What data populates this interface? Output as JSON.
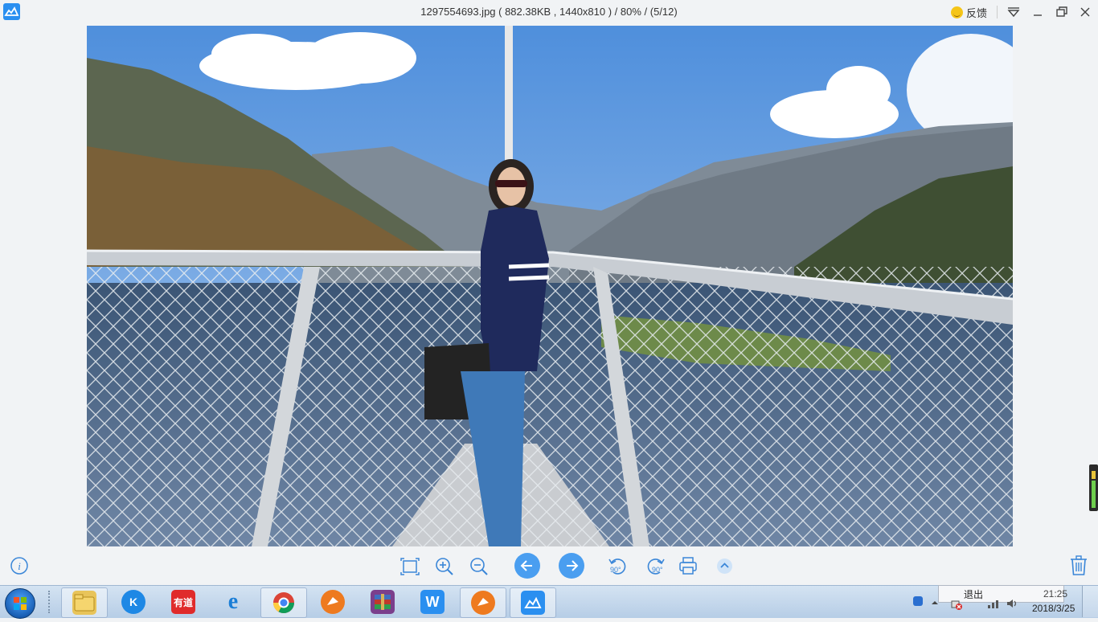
{
  "window": {
    "title": "1297554693.jpg ( 882.38KB , 1440x810 ) / 80% / (5/12)",
    "feedback_label": "反馈",
    "icons": [
      "app-logo-icon",
      "smiley-icon",
      "dropdown-icon",
      "minimize-icon",
      "restore-icon",
      "close-icon"
    ]
  },
  "toolbar": {
    "rotate_left_label": "90°",
    "rotate_right_label": "90°",
    "icons": [
      "info-icon",
      "fit-screen-icon",
      "zoom-in-icon",
      "zoom-out-icon",
      "previous-icon",
      "next-icon",
      "rotate-left-icon",
      "rotate-right-icon",
      "print-icon",
      "expand-up-icon",
      "trash-icon"
    ]
  },
  "taskbar": {
    "apps": [
      {
        "name": "file-explorer",
        "label": ""
      },
      {
        "name": "k-app",
        "label": "K"
      },
      {
        "name": "youdao-dictionary",
        "label": "有道"
      },
      {
        "name": "internet-explorer",
        "label": "e"
      },
      {
        "name": "chrome",
        "label": ""
      },
      {
        "name": "fox-app",
        "label": ""
      },
      {
        "name": "winrar",
        "label": ""
      },
      {
        "name": "wps-writer",
        "label": "W"
      },
      {
        "name": "fox-app-2",
        "label": ""
      },
      {
        "name": "image-viewer",
        "label": ""
      }
    ],
    "tooltip": "退出",
    "clock_time": "21:25",
    "clock_date": "2018/3/25"
  },
  "colors": {
    "accent": "#4a9ef0",
    "background": "#f1f3f5",
    "sky": "#6aa0dd"
  }
}
